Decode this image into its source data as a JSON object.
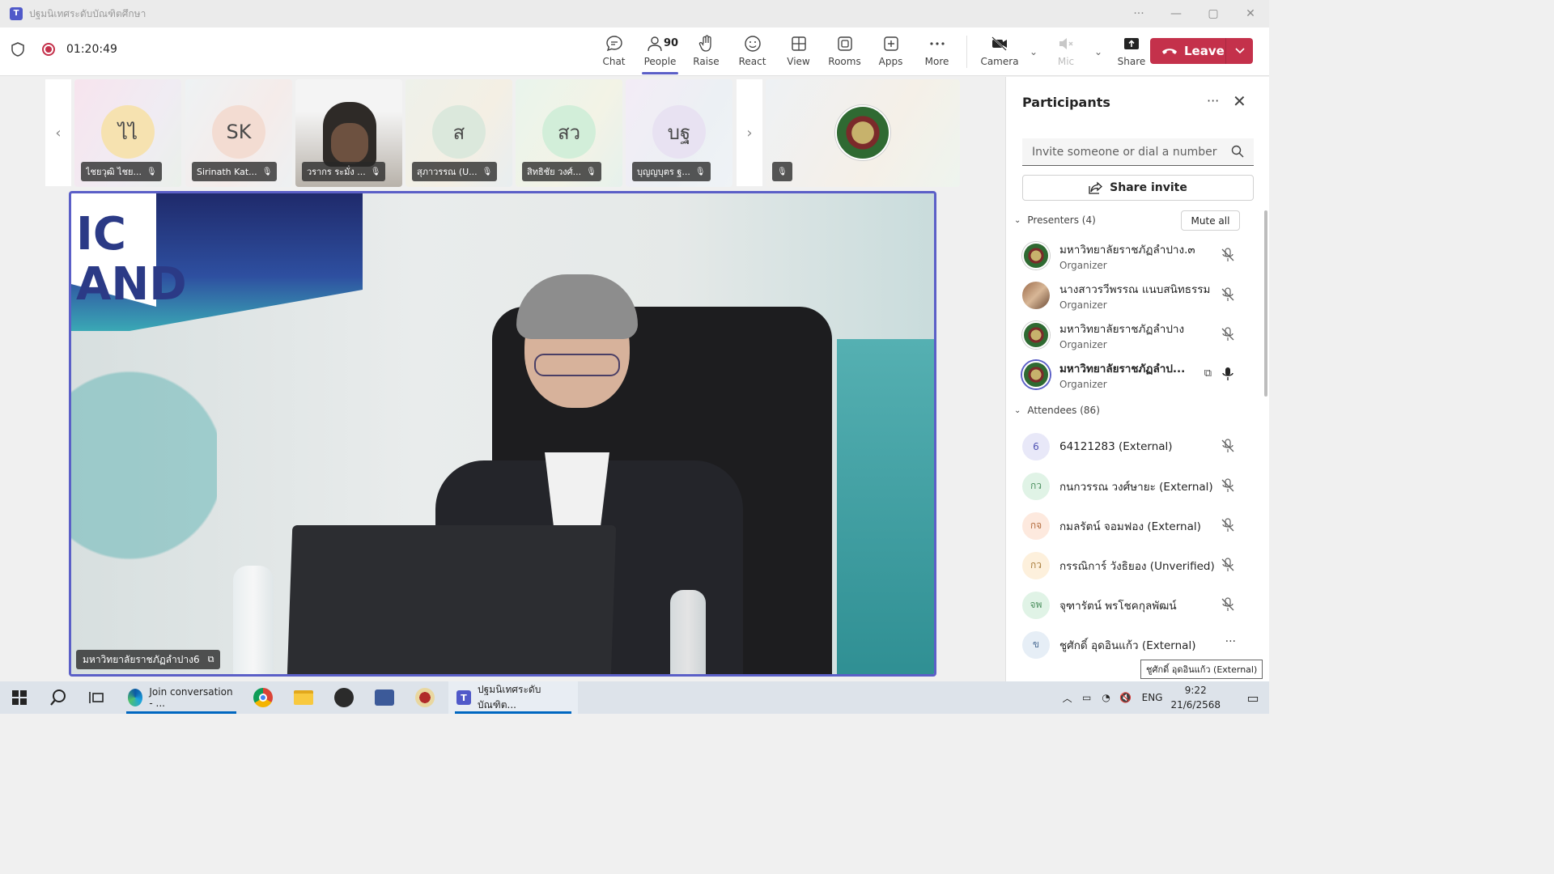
{
  "window": {
    "title": "ปฐมนิเทศระดับบัณฑิตศึกษา",
    "controls": [
      "···",
      "—",
      "▢",
      "✕"
    ]
  },
  "toolbar": {
    "timer": "01:20:49",
    "tools": [
      {
        "label": "Chat",
        "icon": "chat-icon"
      },
      {
        "label": "People",
        "icon": "people-icon",
        "count": "90"
      },
      {
        "label": "Raise",
        "icon": "raise-hand-icon"
      },
      {
        "label": "React",
        "icon": "react-icon"
      },
      {
        "label": "View",
        "icon": "view-icon"
      },
      {
        "label": "Rooms",
        "icon": "rooms-icon"
      },
      {
        "label": "Apps",
        "icon": "apps-icon"
      },
      {
        "label": "More",
        "icon": "more-icon"
      }
    ],
    "camera": "Camera",
    "mic": "Mic",
    "share": "Share",
    "leave": "Leave"
  },
  "strip": [
    {
      "initials": "ไไ",
      "name": "ไชยวุฒิ ไชย...",
      "bg": "#f6e2b0"
    },
    {
      "initials": "SK",
      "name": "Sirinath Kat...",
      "bg": "#f3dcd2"
    },
    {
      "initials": "",
      "name": "วรากร ระมั่ง ...",
      "bg": "#ffffff"
    },
    {
      "initials": "ส",
      "name": "สุภาวรรณ (U...",
      "bg": "#dbe8dc"
    },
    {
      "initials": "สว",
      "name": "สิทธิชัย วงศ์...",
      "bg": "#d2eed9"
    },
    {
      "initials": "บฐ",
      "name": "บุญญบุตร ฐ...",
      "bg": "#e8e2f2"
    }
  ],
  "main_video": {
    "name": "มหาวิทยาลัยราชภัฏลำปาง6"
  },
  "panel": {
    "title": "Participants",
    "search_placeholder": "Invite someone or dial a number",
    "share_invite": "Share invite",
    "presenters_label": "Presenters (4)",
    "mute_all": "Mute all",
    "presenters": [
      {
        "name": "มหาวิทยาลัยราชภัฏลำปาง.๓",
        "role": "Organizer"
      },
      {
        "name": "นางสาวรวีพรรณ แนบสนิทธรรม",
        "role": "Organizer"
      },
      {
        "name": "มหาวิทยาลัยราชภัฏลำปาง",
        "role": "Organizer"
      },
      {
        "name": "มหาวิทยาลัยราชภัฏลำป...",
        "role": "Organizer"
      }
    ],
    "attendees_label": "Attendees (86)",
    "attendees": [
      {
        "initials": "6",
        "name": "64121283 (External)",
        "bg": "#e8e8f8",
        "fg": "#4f52b2"
      },
      {
        "initials": "กว",
        "name": "กนกวรรณ วงศ์ษายะ (External)",
        "bg": "#e0f3e6",
        "fg": "#4b8f5e"
      },
      {
        "initials": "กจ",
        "name": "กมลรัตน์ จอมฟอง (External)",
        "bg": "#fde9de",
        "fg": "#b26a3c"
      },
      {
        "initials": "กว",
        "name": "กรรณิการ์ วังธิยอง (Unverified)",
        "bg": "#fdf0dc",
        "fg": "#a77b3a"
      },
      {
        "initials": "จพ",
        "name": "จุฑารัตน์ พรโชคกุลพัฒน์",
        "bg": "#e0f3e6",
        "fg": "#4b8f5e"
      },
      {
        "initials": "ข",
        "name": "ชูศักดิ์ อุดอินแก้ว (External)",
        "bg": "#e6eef6",
        "fg": "#4d6e95"
      }
    ],
    "tooltip": "ชูศักดิ์ อุดอินแก้ว (External)"
  },
  "taskbar": {
    "edge_label": "Join conversation - ...",
    "teams_label": "ปฐมนิเทศระดับบัณฑิต...",
    "lang": "ENG",
    "time": "9:22",
    "date": "21/6/2568"
  }
}
